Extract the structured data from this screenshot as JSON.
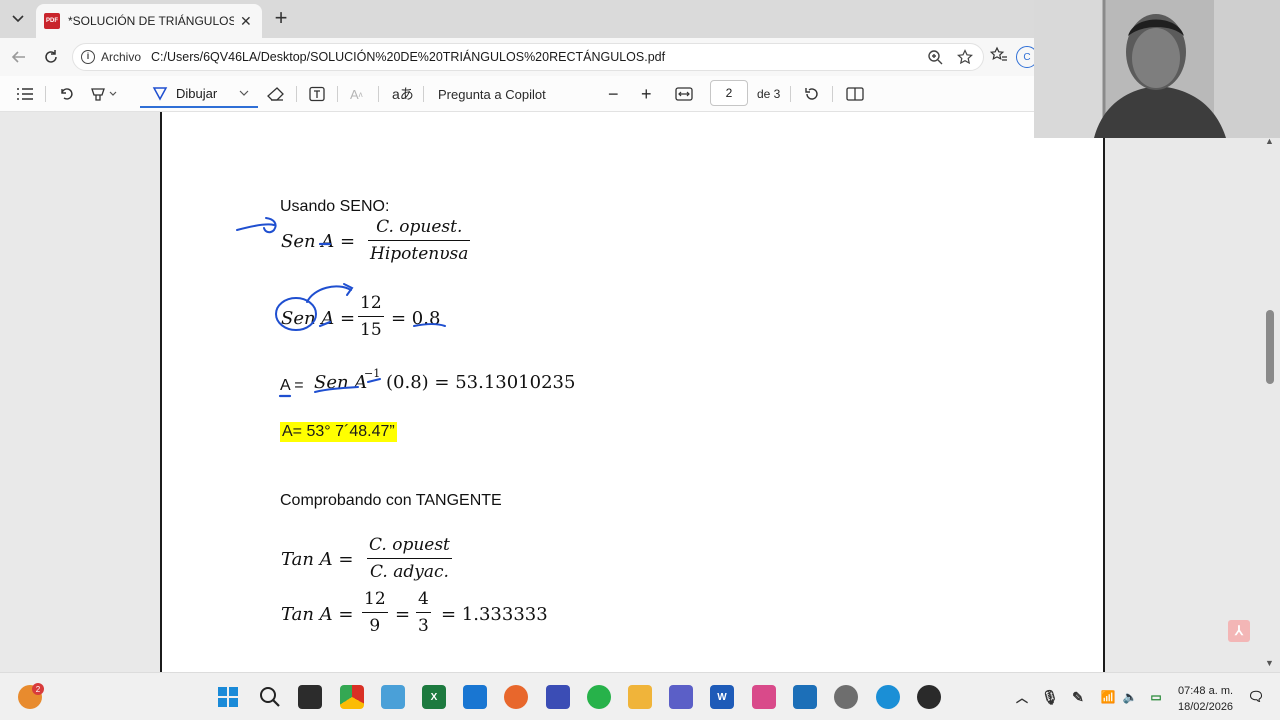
{
  "browser": {
    "tab_title": "*SOLUCIÓN DE TRIÁNGULOS RECTÁNGULOS",
    "site_label": "Archivo",
    "url": "C:/Users/6QV46LA/Desktop/SOLUCIÓN%20DE%20TRIÁNGULOS%20RECTÁNGULOS.pdf",
    "profile_letter": "C"
  },
  "pdf_toolbar": {
    "draw_label": "Dibujar",
    "copilot_label": "Pregunta a Copilot",
    "current_page": "2",
    "page_total": "de 3"
  },
  "document": {
    "heading_seno": "Usando SENO:",
    "sen_lhs": "Sen A =",
    "sen_num": "C. opuest.",
    "sen_den": "Hipotenυsa",
    "sen2_lhs": "Sen A =",
    "sen2_num": "12",
    "sen2_den": "15",
    "sen2_rhs": "= 0.8",
    "inverse_prefix": "A =",
    "inverse_expr": "Sen A",
    "inverse_exp": "−1",
    "inverse_rhs": "(0.8) = 53.13010235",
    "result_highlight": "A= 53° 7´48.47”",
    "heading_tan": "Comprobando con TANGENTE",
    "tan_lhs": "Tan A =",
    "tan_num": "C. opuest",
    "tan_den": "C. adyac.",
    "tan2_lhs": "Tan A =",
    "tan2_num1": "12",
    "tan2_den1": "9",
    "tan2_eq": "=",
    "tan2_num2": "4",
    "tan2_den2": "3",
    "tan2_rhs": "= 1.333333"
  },
  "taskbar": {
    "time": "07:48 a. m.",
    "date": "18/02/2026",
    "widgets_badge": "2"
  },
  "icons": [
    "menu-icon",
    "pdf-icon",
    "close-icon",
    "plus-icon",
    "back-icon",
    "refresh-icon",
    "info-icon",
    "zoom-icon",
    "star-icon",
    "favorites-icon",
    "contents-icon",
    "undo-icon",
    "highlight-icon",
    "draw-icon",
    "eraser-icon",
    "text-icon",
    "read-aloud-icon",
    "translate-icon",
    "zoom-out-icon",
    "zoom-in-icon",
    "fit-icon",
    "rotate-icon",
    "two-page-icon",
    "windows-icon",
    "search-icon"
  ],
  "colors": {
    "accent": "#2f6fd6",
    "ink": "#1f4fd0",
    "highlight": "#ffff00",
    "pdf_red": "#c9252c"
  }
}
